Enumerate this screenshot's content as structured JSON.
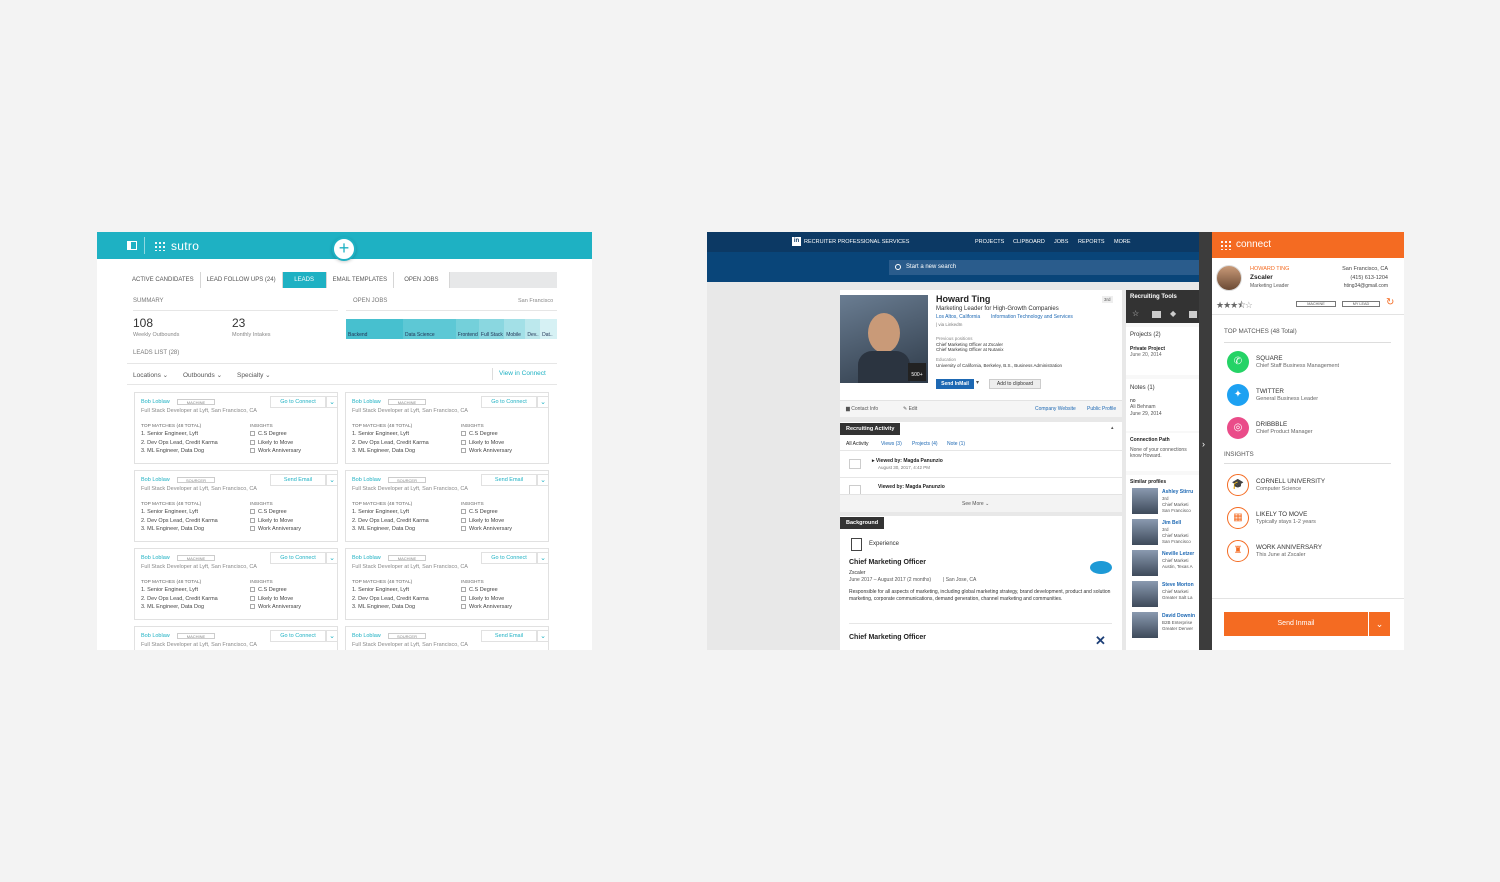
{
  "sutro": {
    "brand": "sutro",
    "tabs": [
      "ACTIVE CANDIDATES",
      "LEAD FOLLOW UPS (24)",
      "LEADS",
      "EMAIL TEMPLATES",
      "OPEN JOBS"
    ],
    "summary": "SUMMARY",
    "weekly_value": "108",
    "weekly_label": "Weekly Outbounds",
    "monthly_value": "23",
    "monthly_label": "Monthly Intakes",
    "open_jobs": "OPEN JOBS",
    "location": "San Francisco",
    "job_bars": [
      {
        "label": "Backend",
        "color": "#47c0cf",
        "share": 0.27
      },
      {
        "label": "Data Science",
        "color": "#5dc8d5",
        "share": 0.25
      },
      {
        "label": "Frontend",
        "color": "#74d0da",
        "share": 0.11
      },
      {
        "label": "Full Stack",
        "color": "#8ad7e0",
        "share": 0.12
      },
      {
        "label": "Mobile",
        "color": "#a3e0e7",
        "share": 0.1
      },
      {
        "label": "Dev..",
        "color": "#bce8ed",
        "share": 0.07
      },
      {
        "label": "Dat..",
        "color": "#d6f1f4",
        "share": 0.08
      }
    ],
    "leads_list": "LEADS LIST (28)",
    "filters": [
      "Locations",
      "Outbounds",
      "Specialty"
    ],
    "view_connect": "View in Connect",
    "card_common": {
      "name": "Bob Loblaw",
      "role": "Full Stack Developer at Lyft, San Francisco, CA",
      "top_matches": "TOP MATCHES (48 TOTAL)",
      "insights": "INSIGHTS",
      "matches": [
        "1. Senior Engineer, Lyft",
        "2. Dev Ops Lead, Credit Karma",
        "3. ML Engineer, Data Dog"
      ],
      "insight_items": [
        "C.S Degree",
        "Likely to Move",
        "Work Anniversary"
      ]
    },
    "cards": [
      {
        "badge": "MACHINE",
        "action": "Go to Connect"
      },
      {
        "badge": "MACHINE",
        "action": "Go to Connect"
      },
      {
        "badge": "SOURCER",
        "action": "Send Email"
      },
      {
        "badge": "SOURCER",
        "action": "Send Email"
      },
      {
        "badge": "MACHINE",
        "action": "Go to Connect"
      },
      {
        "badge": "MACHINE",
        "action": "Go to Connect"
      },
      {
        "badge": "MACHINE",
        "action": "Go to Connect"
      },
      {
        "badge": "SOURCER",
        "action": "Send Email"
      }
    ]
  },
  "linkedin": {
    "product": "RECRUITER PROFESSIONAL SERVICES",
    "nav": [
      "PROJECTS",
      "CLIPBOARD",
      "JOBS",
      "REPORTS",
      "MORE"
    ],
    "search_placeholder": "Start a new search",
    "name": "Howard Ting",
    "degree": "3rd",
    "headline": "Marketing Leader for High-Growth Companies",
    "location": "Los Altos, California",
    "industry": "Information Technology and Services",
    "via": "via LinkedIn",
    "prev_label": "Previous positions",
    "prev1": "Chief Marketing Officer at Zscaler",
    "prev2": "Chief Marketing Officer at Nutanix",
    "edu_label": "Education",
    "edu": "University of California, Berkeley, B.S., Business Administration",
    "connections": "500+",
    "send_inmail": "Send InMail",
    "add_clip": "Add to clipboard",
    "contact_info": "Contact Info",
    "edit": "Edit",
    "company_site": "Company Website",
    "public_profile": "Public Profile",
    "recruiting_activity": "Recruiting Activity",
    "activity_tabs": [
      "All Activity",
      "Views (3)",
      "Projects (4)",
      "Note (1)"
    ],
    "view1": "Viewed by: Magda Panunzio",
    "view1_date": "August 30, 2017, 4:42 PM",
    "view2": "Viewed by: Magda Panunzio",
    "see_more": "See More",
    "background": "Background",
    "experience": "Experience",
    "job1_title": "Chief Marketing Officer",
    "job1_company": "Zscaler",
    "job1_dates": "June 2017 – August 2017 (2 months)",
    "job1_loc": "San Jose, CA",
    "job1_desc": "Responsible for all aspects of marketing, including global marketing strategy, brand development, product and solution marketing, corporate communications, demand generation, channel marketing and communities.",
    "job2_title": "Chief Marketing Officer",
    "tools_title": "Recruiting Tools",
    "projects_label": "Projects (2)",
    "project_name": "Private Project",
    "project_date": "June 20, 2014",
    "notes_label": "Notes (1)",
    "note_text": "no",
    "note_by": "Ali Behnam",
    "note_date": "June 29, 2014",
    "conn_path": "Connection Path",
    "conn_text": "None of your connections know Howard.",
    "similar_title": "Similar profiles",
    "similar": [
      {
        "name": "Ashley Stirru",
        "l1": "3rd",
        "l2": "Chief Marketi",
        "l3": "San Francisco"
      },
      {
        "name": "Jim Bell",
        "l1": "3rd",
        "l2": "Chief Marketi",
        "l3": "San Francisco"
      },
      {
        "name": "Neville Letzer",
        "l1": "Chief Marketi",
        "l2": "Austin, Texas A",
        "l3": ""
      },
      {
        "name": "Steve Morton",
        "l1": "Chief Marketi",
        "l2": "Greater Salt La",
        "l3": ""
      },
      {
        "name": "David Downin",
        "l1": "B2B Enterprise",
        "l2": "Greater Denver",
        "l3": ""
      }
    ]
  },
  "connect": {
    "brand": "connect",
    "name": "HOWARD TING",
    "company": "Zscaler",
    "title": "Marketing Leader",
    "location": "San Francisco, CA",
    "phone": "(415) 613-1204",
    "email": "hting34@gmail.com",
    "rating": 3.5,
    "badge1": "MACHINE",
    "badge2": "MY LEAD",
    "top_matches": "TOP MATCHES (48 Total)",
    "matches": [
      {
        "company": "SQUARE",
        "role": "Chief Staff Business Management",
        "icon": "whatsapp-icon",
        "color": "#25d366"
      },
      {
        "company": "TWITTER",
        "role": "General Business Leader",
        "icon": "twitter-icon",
        "color": "#1da1f2"
      },
      {
        "company": "DRIBBBLE",
        "role": "Chief Product Manager",
        "icon": "dribbble-icon",
        "color": "#ea4c89"
      }
    ],
    "insights_title": "INSIGHTS",
    "insights": [
      {
        "title": "CORNELL UNIVERSITY",
        "sub": "Computer Science",
        "icon": "graduation-cap-icon"
      },
      {
        "title": "LIKELY TO MOVE",
        "sub": "Typically stays 1-2 years",
        "icon": "calendar-icon"
      },
      {
        "title": "WORK ANNIVERSARY",
        "sub": "This June at Zscaler",
        "icon": "cake-icon"
      }
    ],
    "send": "Send Inmail",
    "accent": "#f46b22"
  }
}
